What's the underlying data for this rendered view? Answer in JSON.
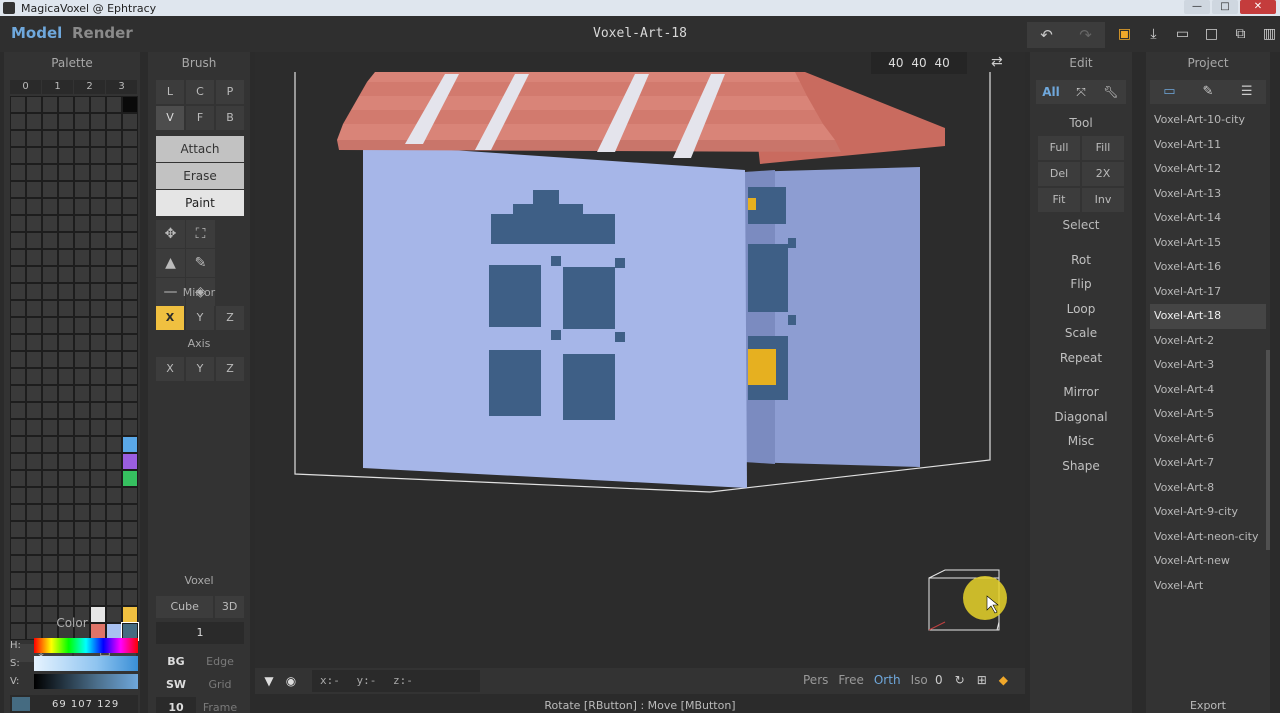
{
  "window": {
    "title": "MagicaVoxel @ Ephtracy"
  },
  "topbar": {
    "mode_model": "Model",
    "mode_render": "Render",
    "doc_title": "Voxel-Art-18"
  },
  "palette": {
    "header": "Palette",
    "tabs": [
      "0",
      "1",
      "2",
      "3"
    ],
    "color_label": "Color",
    "h_label": "H:",
    "s_label": "S:",
    "v_label": "V:",
    "rgb": "69 107 129",
    "selected_color": "#456b81"
  },
  "brush": {
    "header": "Brush",
    "modes": [
      "L",
      "C",
      "P",
      "V",
      "F",
      "B"
    ],
    "active_mode": "V",
    "actions": [
      "Attach",
      "Erase",
      "Paint"
    ],
    "active_action": "Paint",
    "mirror_label": "Mirror",
    "mirror": [
      "X",
      "Y",
      "Z"
    ],
    "axis_label": "Axis",
    "axis": [
      "X",
      "Y",
      "Z"
    ],
    "voxel_label": "Voxel",
    "voxel_type": "Cube",
    "voxel_3d": "3D",
    "size": "1",
    "bg": "BG",
    "edge": "Edge",
    "sw": "SW",
    "grid": "Grid",
    "frame_num": "10",
    "frame": "Frame"
  },
  "viewport": {
    "dimensions": "40 40 40",
    "coords": "x:-  y:-  z:-",
    "view_modes": [
      "Pers",
      "Free",
      "Orth",
      "Iso"
    ],
    "active_view": "Orth",
    "angle": "0",
    "status": "Rotate [RButton] : Move [MButton]"
  },
  "edit": {
    "header": "Edit",
    "tab_all": "All",
    "tool_label": "Tool",
    "tools": [
      "Full",
      "Fill",
      "Del",
      "2X",
      "Fit",
      "Inv"
    ],
    "select_label": "Select",
    "items": [
      "Rot",
      "Flip",
      "Loop",
      "Scale",
      "Repeat",
      "Mirror",
      "Diagonal",
      "Misc",
      "Shape"
    ]
  },
  "project": {
    "header": "Project",
    "items": [
      "Voxel-Art-10-city",
      "Voxel-Art-11",
      "Voxel-Art-12",
      "Voxel-Art-13",
      "Voxel-Art-14",
      "Voxel-Art-15",
      "Voxel-Art-16",
      "Voxel-Art-17",
      "Voxel-Art-18",
      "Voxel-Art-2",
      "Voxel-Art-3",
      "Voxel-Art-4",
      "Voxel-Art-5",
      "Voxel-Art-6",
      "Voxel-Art-7",
      "Voxel-Art-8",
      "Voxel-Art-9-city",
      "Voxel-Art-neon-city",
      "Voxel-Art-new",
      "Voxel-Art"
    ],
    "selected": "Voxel-Art-18",
    "export": "Export"
  },
  "colors": {
    "accent_blue": "#6fa8dc",
    "accent_yellow": "#f0c040",
    "wall": "#a4b4e6",
    "wall_side": "#8c9cd3",
    "roof": "#d87b6e",
    "window": "#3e5f86"
  }
}
